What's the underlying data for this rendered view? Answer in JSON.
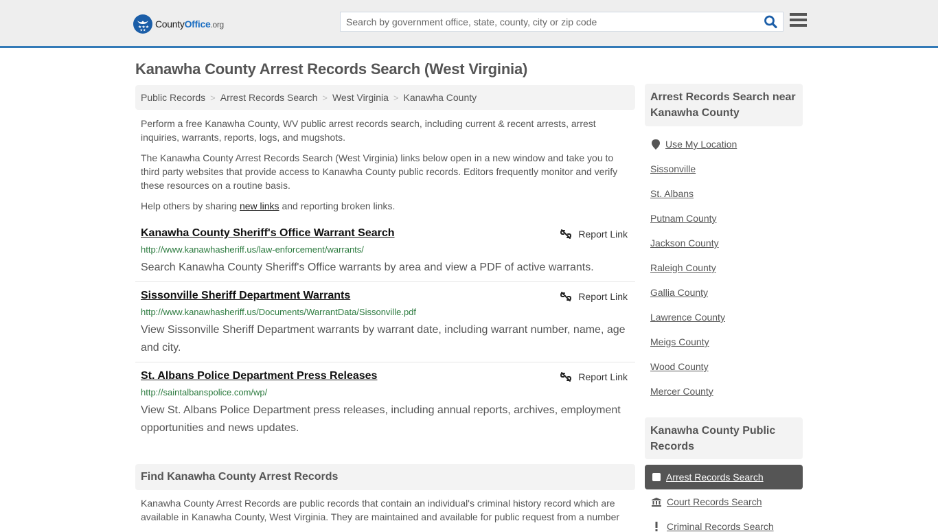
{
  "header": {
    "logo": {
      "name_part1": "County",
      "name_part2": "Office",
      "tld": ".org"
    },
    "search": {
      "placeholder": "Search by government office, state, county, city or zip code",
      "value": ""
    },
    "colors": {
      "accent": "#337ab7",
      "logo_blue": "#1b5ea8"
    }
  },
  "page": {
    "title": "Kanawha County Arrest Records Search (West Virginia)",
    "breadcrumb": [
      "Public Records",
      "Arrest Records Search",
      "West Virginia",
      "Kanawha County"
    ],
    "intro": {
      "p1": "Perform a free Kanawha County, WV public arrest records search, including current & recent arrests, arrest inquiries, warrants, reports, logs, and mugshots.",
      "p2": "The Kanawha County Arrest Records Search (West Virginia) links below open in a new window and take you to third party websites that provide access to Kanawha County public records. Editors frequently monitor and verify these resources on a routine basis.",
      "p3_before": "Help others by sharing ",
      "p3_link": "new links",
      "p3_after": " and reporting broken links."
    },
    "results": [
      {
        "title": "Kanawha County Sheriff's Office Warrant Search",
        "url": "http://www.kanawhasheriff.us/law-enforcement/warrants/",
        "description": "Search Kanawha County Sheriff's Office warrants by area and view a PDF of active warrants.",
        "report_label": "Report Link"
      },
      {
        "title": "Sissonville Sheriff Department Warrants",
        "url": "http://www.kanawhasheriff.us/Documents/WarrantData/Sissonville.pdf",
        "description": "View Sissonville Sheriff Department warrants by warrant date, including warrant number, name, age and city.",
        "report_label": "Report Link"
      },
      {
        "title": "St. Albans Police Department Press Releases",
        "url": "http://saintalbanspolice.com/wp/",
        "description": "View St. Albans Police Department press releases, including annual reports, archives, employment opportunities and news updates.",
        "report_label": "Report Link"
      }
    ],
    "find_section": {
      "heading": "Find Kanawha County Arrest Records",
      "body": "Kanawha County Arrest Records are public records that contain an individual's criminal history record which are available in Kanawha County, West Virginia. They are maintained and available for public request from a number"
    }
  },
  "sidebar": {
    "nearby": {
      "heading": "Arrest Records Search near Kanawha County",
      "use_location": "Use My Location",
      "links": [
        "Sissonville",
        "St. Albans",
        "Putnam County",
        "Jackson County",
        "Raleigh County",
        "Gallia County",
        "Lawrence County",
        "Meigs County",
        "Wood County",
        "Mercer County"
      ]
    },
    "public_records": {
      "heading": "Kanawha County Public Records",
      "items": [
        {
          "label": "Arrest Records Search",
          "icon": "square-icon",
          "active": true
        },
        {
          "label": "Court Records Search",
          "icon": "courthouse-icon",
          "active": false
        },
        {
          "label": "Criminal Records Search",
          "icon": "exclamation-icon",
          "active": false
        }
      ]
    }
  }
}
